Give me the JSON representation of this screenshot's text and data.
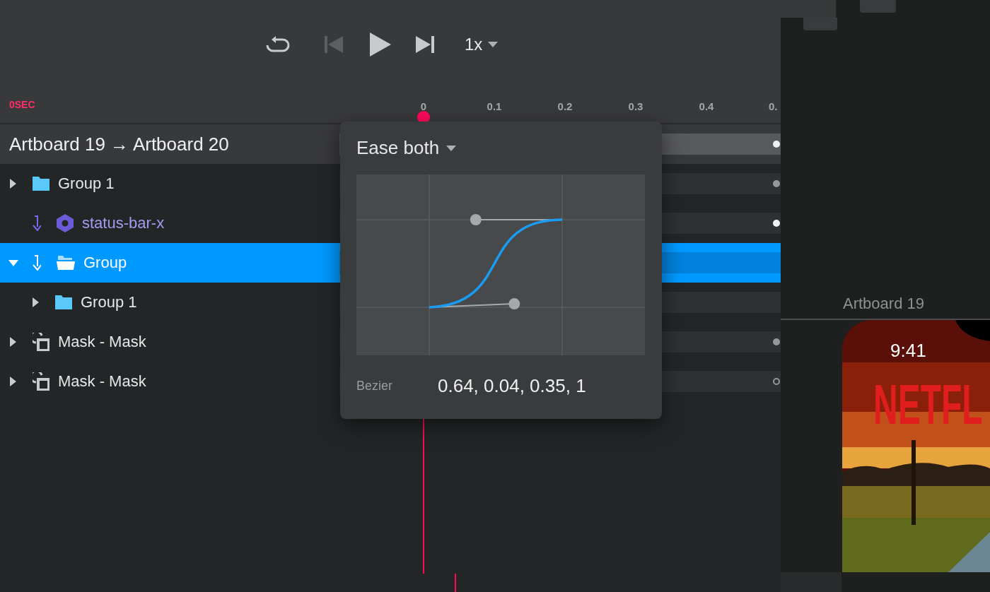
{
  "playback": {
    "prev_disabled": true,
    "speed": "1x"
  },
  "ruler": {
    "unit": "0SEC",
    "ticks": [
      "0",
      "0.1",
      "0.2",
      "0.3",
      "0.4",
      "0."
    ]
  },
  "transition": {
    "title": "Artboard 19 → Artboard 20",
    "keyframe": {
      "kind": "solid"
    }
  },
  "layers": [
    {
      "name": "Group 1",
      "kind": "folder",
      "expanded": false,
      "selected": false,
      "linked": false,
      "keyframe": {
        "kind": "dim"
      }
    },
    {
      "name": "status-bar-x",
      "kind": "component",
      "selected": false,
      "linked": true,
      "keyframe": {
        "kind": "solid"
      }
    },
    {
      "name": "Group",
      "kind": "folder",
      "expanded": true,
      "selected": true,
      "linked": true,
      "children": [
        {
          "name": "Group 1",
          "kind": "folder",
          "expanded": false,
          "selected": false,
          "linked": false
        }
      ]
    },
    {
      "name": "Mask - Mask",
      "kind": "mask",
      "expanded": false,
      "selected": false,
      "linked": false,
      "keyframe": {
        "kind": "dim"
      }
    },
    {
      "name": "Mask - Mask",
      "kind": "mask",
      "expanded": false,
      "selected": false,
      "linked": false,
      "keyframe": {
        "kind": "hollow"
      }
    }
  ],
  "easing": {
    "title": "Ease both",
    "curve_label": "Bezier",
    "curve_value": "0.64, 0.04, 0.35, 1"
  },
  "artboard": {
    "label": "Artboard 19",
    "time": "9:41",
    "logo": "NETFL"
  }
}
